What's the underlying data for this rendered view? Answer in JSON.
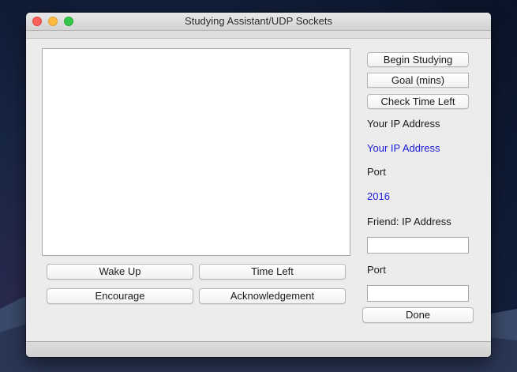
{
  "window": {
    "title": "Studying Assistant/UDP Sockets"
  },
  "log": {
    "text": ""
  },
  "controls": {
    "begin_studying": "Begin Studying",
    "goal": "Goal (mins)",
    "check_time_left": "Check Time Left"
  },
  "network": {
    "your_ip_label": "Your IP Address",
    "your_ip_value": "Your IP Address",
    "port_label": "Port",
    "port_value": "2016",
    "friend_ip_label": "Friend: IP Address",
    "friend_ip_value": "",
    "friend_port_label": "Port",
    "friend_port_value": "",
    "done": "Done"
  },
  "actions": {
    "wake_up": "Wake Up",
    "time_left": "Time Left",
    "encourage": "Encourage",
    "acknowledgement": "Acknowledgement"
  },
  "colors": {
    "value_text": "#1a1adc",
    "window_bg": "#ececec"
  }
}
